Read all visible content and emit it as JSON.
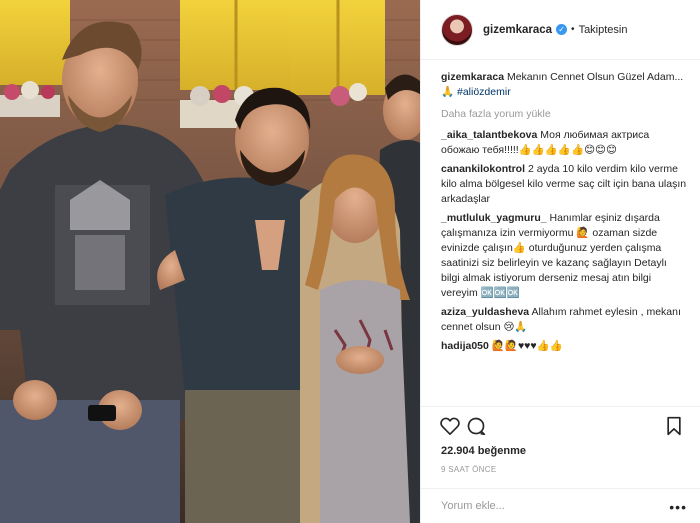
{
  "post": {
    "username": "gizemkaraca",
    "follow_status": "Takiptesin",
    "separator": "•",
    "likes": "22.904 beğenme",
    "time": "9 SAAT ÖNCE",
    "comment_placeholder": "Yorum ekle...",
    "more_comments": "Daha fazla yorum yükle",
    "more_icon": "•••"
  },
  "caption": {
    "user": "gizemkaraca",
    "text": "Mekanın Cennet Olsun Güzel Adam... 🙏",
    "hashtag": "#aliözdemir"
  },
  "comments": [
    {
      "user": "_aika_talantbekova",
      "text": "Моя любимая актриса обожаю тебя!!!!!👍👍👍👍👍😊😊😊"
    },
    {
      "user": "canankilokontrol",
      "text": "2 ayda 10 kilo verdim kilo verme kilo alma bölgesel kilo verme saç cilt için bana ulaşın arkadaşlar"
    },
    {
      "user": "_mutluluk_yagmuru_",
      "text": "Hanımlar eşiniz dışarda çalışmanıza izin vermiyormu 🙋 ozaman sizde evinizde çalışın👍 oturduğunuz yerden çalışma saatinizi siz belirleyin ve kazanç sağlayın Detaylı bilgi almak istiyorum derseniz mesaj atın bilgi vereyim 🆗🆗🆗"
    },
    {
      "user": "aziza_yuldasheva",
      "text": "Allahım rahmet eylesin , mekanı cennet olsun 😢🙏"
    },
    {
      "user": "hadija050",
      "text": "🙋🙋♥♥♥👍👍"
    }
  ],
  "icons": {
    "like": "heart-icon",
    "comment": "comment-icon",
    "save": "bookmark-icon",
    "verified": "verified-badge-icon",
    "verified_glyph": "✓"
  },
  "colors": {
    "link": "#003569",
    "verified": "#3897f0",
    "muted": "#999999"
  }
}
